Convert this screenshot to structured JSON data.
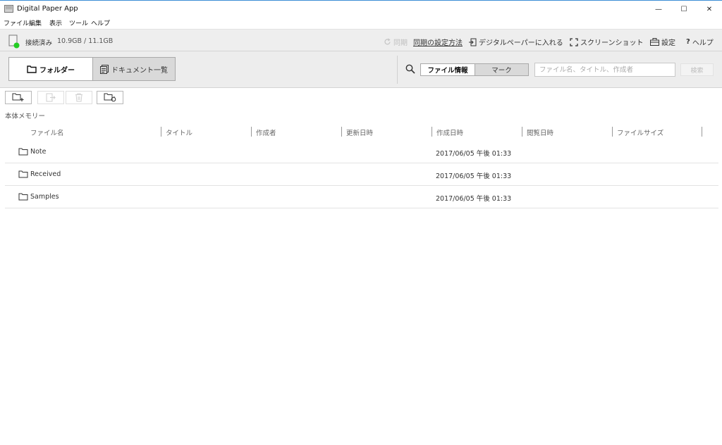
{
  "window": {
    "title": "Digital Paper App",
    "minimize_glyph": "—",
    "maximize_glyph": "☐",
    "close_glyph": "✕"
  },
  "menu": [
    "ファイル",
    "編集",
    "表示",
    "ツール",
    "ヘルプ"
  ],
  "status": {
    "connection": "接続済み",
    "capacity": "10.9GB / 11.1GB",
    "sync": "同期",
    "sync_setup": "同期の設定方法",
    "import": "デジタルペーパーに入れる",
    "screenshot": "スクリーンショット",
    "settings": "設定",
    "help": "ヘルプ",
    "connected_color": "#22cc22"
  },
  "toolbar": {
    "folder_tab": "フォルダー",
    "doclist_tab": "ドキュメント一覧",
    "file_info_tab": "ファイル情報",
    "mark_tab": "マーク",
    "search_placeholder": "ファイル名、タイトル、作成者",
    "search_button": "検索"
  },
  "section_label": "本体メモリー",
  "columns": [
    "ファイル名",
    "タイトル",
    "作成者",
    "更新日時",
    "作成日時",
    "閲覧日時",
    "ファイルサイズ"
  ],
  "rows": [
    {
      "name": "Note",
      "created": "2017/06/05 午後 01:33"
    },
    {
      "name": "Received",
      "created": "2017/06/05 午後 01:33"
    },
    {
      "name": "Samples",
      "created": "2017/06/05 午後 01:33"
    }
  ]
}
